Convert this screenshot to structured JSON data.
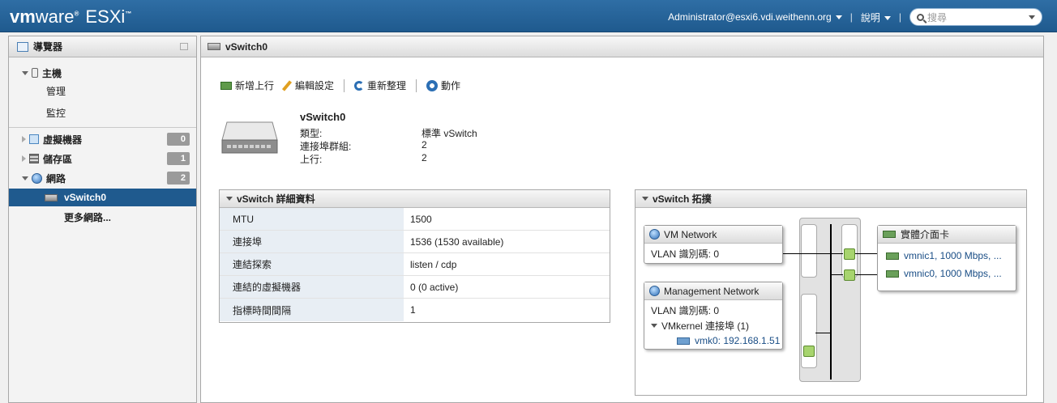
{
  "header": {
    "logo_vm": "vm",
    "logo_ware": "ware",
    "logo_r": "®",
    "logo_esxi": "ESXi",
    "logo_tm": "™",
    "user": "Administrator@esxi6.vdi.weithenn.org",
    "help": "說明",
    "search_placeholder": "搜尋"
  },
  "navigator": {
    "title": "導覽器",
    "host": "主機",
    "manage": "管理",
    "monitor": "監控",
    "vms": {
      "label": "虛擬機器",
      "count": "0"
    },
    "storage": {
      "label": "儲存區",
      "count": "1"
    },
    "network": {
      "label": "網路",
      "count": "2"
    },
    "vswitch": "vSwitch0",
    "more": "更多網路..."
  },
  "main": {
    "title": "vSwitch0",
    "toolbar": {
      "add_uplink": "新增上行",
      "edit": "編輯設定",
      "refresh": "重新整理",
      "actions": "動作"
    },
    "summary": {
      "name": "vSwitch0",
      "type_k": "類型:",
      "type_v": "標準 vSwitch",
      "pg_k": "連接埠群組:",
      "pg_v": "2",
      "uplink_k": "上行:",
      "uplink_v": "2"
    },
    "details": {
      "title": "vSwitch 詳細資料",
      "rows": [
        {
          "k": "MTU",
          "v": "1500"
        },
        {
          "k": "連接埠",
          "v": "1536 (1530 available)"
        },
        {
          "k": "連結探索",
          "v": "listen / cdp"
        },
        {
          "k": "連結的虛擬機器",
          "v": "0 (0 active)"
        },
        {
          "k": "指標時間間隔",
          "v": "1"
        }
      ]
    },
    "topology": {
      "title": "vSwitch 拓撲",
      "vm_network": {
        "name": "VM Network",
        "vlan": "VLAN 識別碼: 0"
      },
      "mgmt_network": {
        "name": "Management Network",
        "vlan": "VLAN 識別碼: 0",
        "vmkernel": "VMkernel 連接埠 (1)",
        "vmk": "vmk0: 192.168.1.51"
      },
      "physical": {
        "title": "實體介面卡",
        "nic1": "vmnic1, 1000 Mbps, ...",
        "nic0": "vmnic0, 1000 Mbps, ..."
      }
    }
  }
}
